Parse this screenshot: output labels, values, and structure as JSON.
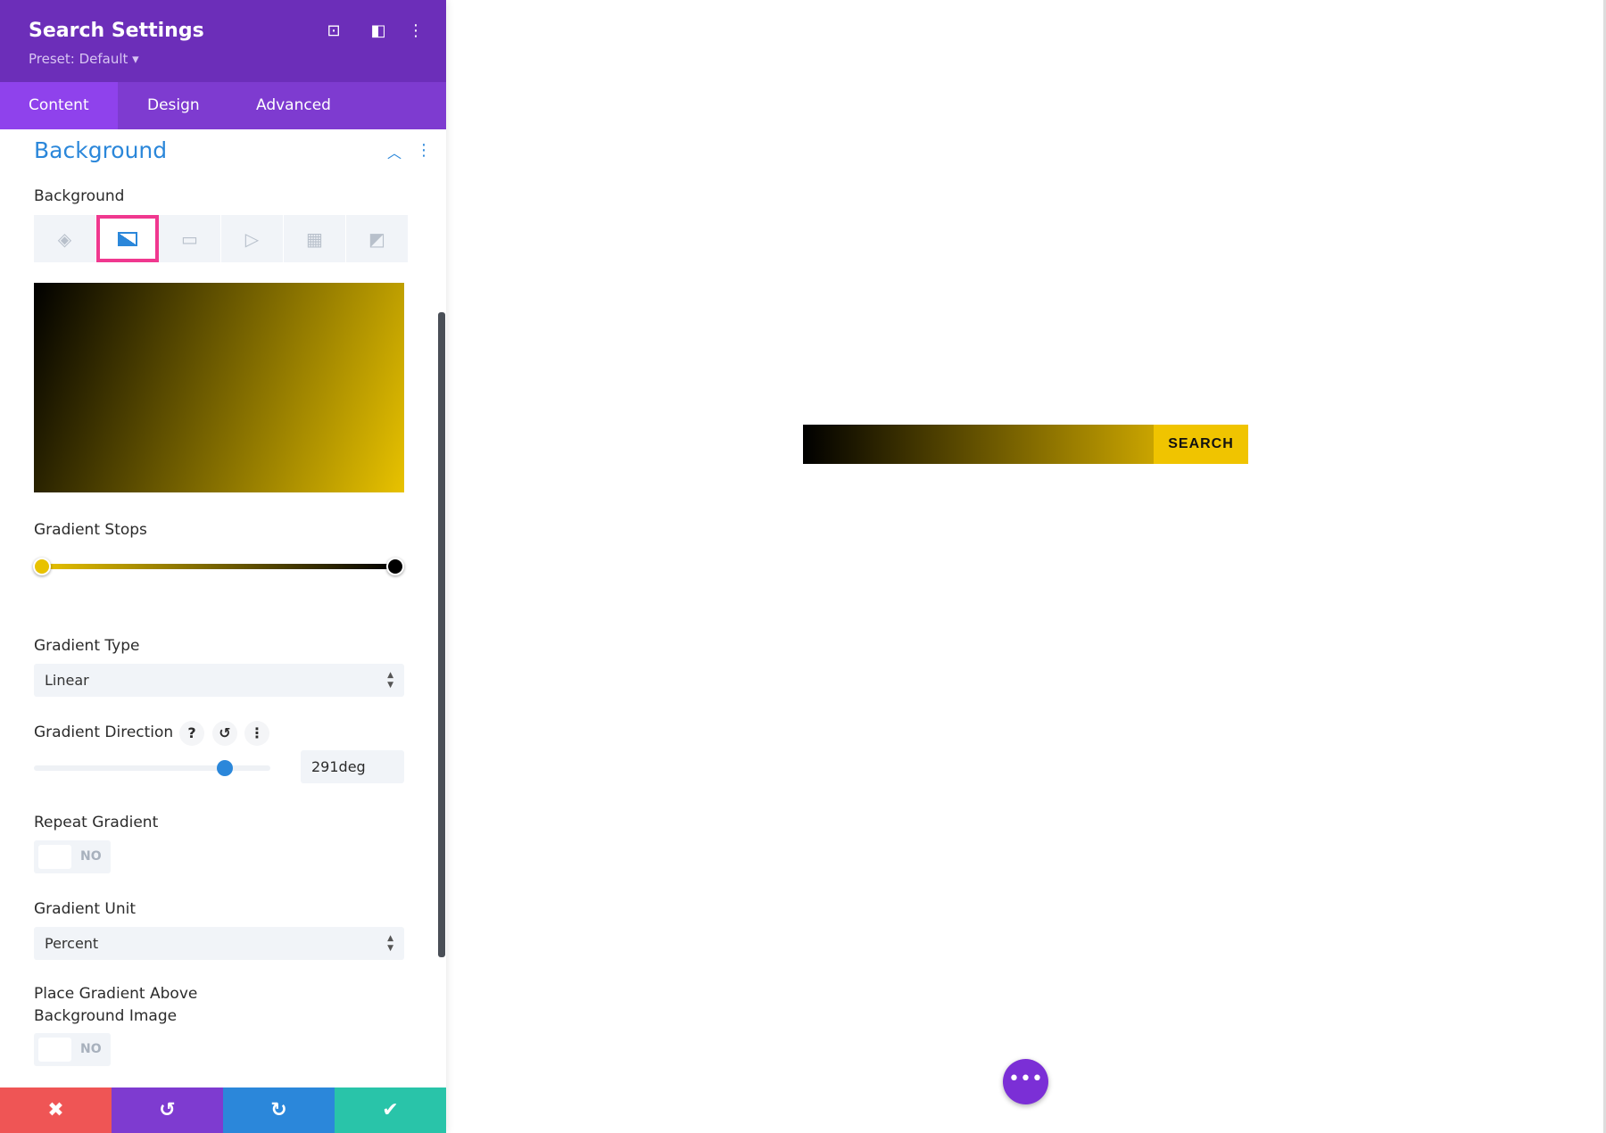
{
  "header": {
    "title": "Search Settings",
    "preset": "Preset: Default ▾",
    "icons": [
      "focus-icon",
      "split-view-icon",
      "more-icon"
    ]
  },
  "tabs": [
    {
      "label": "Content",
      "active": true
    },
    {
      "label": "Design"
    },
    {
      "label": "Advanced"
    }
  ],
  "section": {
    "title": "Background"
  },
  "background": {
    "label": "Background",
    "types": [
      "color",
      "gradient",
      "image",
      "video",
      "pattern",
      "mask"
    ],
    "selected": "gradient"
  },
  "gradient": {
    "start_color": "#e8c200",
    "end_color": "#000000",
    "stops_label": "Gradient Stops",
    "type_label": "Gradient Type",
    "type_value": "Linear",
    "direction_label": "Gradient Direction",
    "direction_value": "291deg",
    "direction_deg": 291,
    "repeat_label": "Repeat Gradient",
    "repeat_value": "NO",
    "unit_label": "Gradient Unit",
    "unit_value": "Percent",
    "above_label_1": "Place Gradient Above",
    "above_label_2": "Background Image",
    "above_value": "NO"
  },
  "footer": {
    "colors": {
      "cancel": "#ef5555",
      "undo": "#7e3bd0",
      "redo": "#2b87da",
      "save": "#29c4a9"
    }
  },
  "canvas": {
    "search_button": "SEARCH",
    "button_color": "#f0c400"
  }
}
